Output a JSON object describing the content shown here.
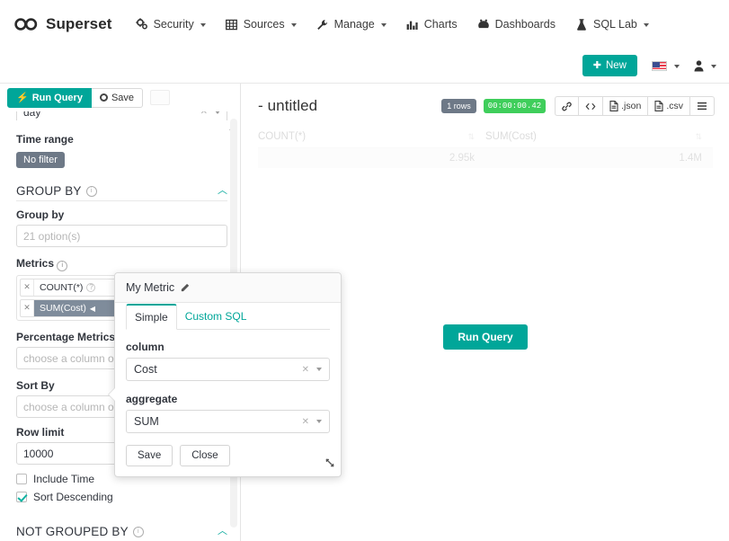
{
  "navbar": {
    "brand": "Superset",
    "brand_icon": "infinity-logo-icon",
    "items": [
      {
        "label": "Security",
        "icon": "gears-icon",
        "has_caret": true
      },
      {
        "label": "Sources",
        "icon": "table-grid-icon",
        "has_caret": true
      },
      {
        "label": "Manage",
        "icon": "wrench-icon",
        "has_caret": true
      },
      {
        "label": "Charts",
        "icon": "bar-chart-icon",
        "has_caret": false
      },
      {
        "label": "Dashboards",
        "icon": "dashboard-icon",
        "has_caret": false
      },
      {
        "label": "SQL Lab",
        "icon": "flask-icon",
        "has_caret": true
      }
    ]
  },
  "subnav": {
    "new_button": "New",
    "new_icon": "plus-icon",
    "language_icon": "us-flag-icon",
    "user_icon": "user-icon"
  },
  "query_toolbar": {
    "run_query": "Run Query",
    "run_icon": "bolt-icon",
    "save": "Save",
    "save_icon": "circle-icon"
  },
  "left_panel": {
    "time_grain_value": "day",
    "time_range_label": "Time range",
    "time_range_value": "No filter",
    "group_by_section": {
      "title": "GROUP BY",
      "info_icon": "info-icon",
      "collapse_icon": "chevron-up-icon"
    },
    "group_by": {
      "label": "Group by",
      "placeholder": "21 option(s)"
    },
    "metrics": {
      "label": "Metrics",
      "info_icon": "info-icon",
      "chips": [
        {
          "label": "COUNT(*)",
          "selected": false,
          "has_help": true
        },
        {
          "label": "SUM(Cost)",
          "selected": true,
          "has_help": false
        }
      ]
    },
    "percentage_metrics": {
      "label": "Percentage Metrics",
      "placeholder": "choose a column o"
    },
    "sort_by": {
      "label": "Sort By",
      "placeholder": "choose a column or aggregate funct"
    },
    "row_limit": {
      "label": "Row limit",
      "value": "10000"
    },
    "checkboxes": [
      {
        "label": "Include Time",
        "checked": false
      },
      {
        "label": "Sort Descending",
        "checked": true
      }
    ],
    "not_grouped_section": {
      "title": "NOT GROUPED BY",
      "info_icon": "info-icon",
      "collapse_icon": "chevron-up-icon"
    }
  },
  "chart_panel": {
    "title": "- untitled",
    "rows_badge": "1 rows",
    "time_badge": "00:00:00.42",
    "toolbar_buttons": [
      {
        "label": "",
        "icon": "link-icon"
      },
      {
        "label": "",
        "icon": "code-icon"
      },
      {
        "label": ".json",
        "icon": "file-icon"
      },
      {
        "label": ".csv",
        "icon": "file-icon"
      },
      {
        "label": "",
        "icon": "hamburger-menu-icon"
      }
    ],
    "results": {
      "columns": [
        "COUNT(*)",
        "SUM(Cost)"
      ],
      "rows": [
        [
          "2.95k",
          "1.4M"
        ]
      ]
    },
    "run_query_button": "Run Query"
  },
  "popover": {
    "title": "My Metric",
    "edit_icon": "pencil-icon",
    "tabs": [
      {
        "label": "Simple",
        "active": true
      },
      {
        "label": "Custom SQL",
        "active": false
      }
    ],
    "column_label": "column",
    "column_value": "Cost",
    "aggregate_label": "aggregate",
    "aggregate_value": "SUM",
    "save_button": "Save",
    "close_button": "Close",
    "resize_icon": "resize-grip-icon"
  },
  "colors": {
    "accent": "#00a699",
    "badge_gray": "#6e7987",
    "badge_green": "#3fce5b",
    "chip_selected": "#7f8c9b"
  }
}
